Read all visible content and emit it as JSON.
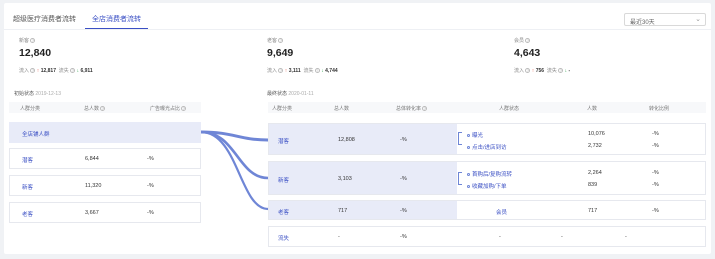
{
  "tabs": [
    {
      "label": "超级医疗消费者流转"
    },
    {
      "label": "全店消费者流转"
    }
  ],
  "select": {
    "value": "最近30天"
  },
  "stats": [
    {
      "label": "新客",
      "value": "12,840",
      "in_label": "流入",
      "in_value": "12,817",
      "out_label": "流失",
      "out_value": "6,911"
    },
    {
      "label": "老客",
      "value": "9,649",
      "in_label": "流入",
      "in_value": "3,111",
      "out_label": "流失",
      "out_value": "4,744"
    },
    {
      "label": "会员",
      "value": "4,643",
      "in_label": "流入",
      "in_value": "756",
      "out_label": "流失",
      "out_value": "-"
    }
  ],
  "left": {
    "date_label": "初始状态",
    "date_value": "2019-12-13",
    "headers": [
      "人群分类",
      "总人数",
      "广告曝光占比"
    ],
    "rows": [
      {
        "name": "全店铺人群",
        "count": "",
        "pct": ""
      },
      {
        "name": "潜客",
        "count": "6,844",
        "pct": "-%"
      },
      {
        "name": "新客",
        "count": "11,320",
        "pct": "-%"
      },
      {
        "name": "老客",
        "count": "3,667",
        "pct": "-%"
      }
    ]
  },
  "right": {
    "date_label": "最终状态",
    "date_value": "2020-01-11",
    "headers": [
      "人群分类",
      "总人数",
      "总体转化率",
      "人群状态",
      "人数",
      "转化比例"
    ],
    "groups": [
      {
        "name": "潜客",
        "count": "12,808",
        "pct": "-%",
        "subs": [
          {
            "label": "曝光",
            "count": "10,076",
            "pct": "-%"
          },
          {
            "label": "点击/进店到访",
            "count": "2,732",
            "pct": "-%"
          }
        ]
      },
      {
        "name": "新客",
        "count": "3,103",
        "pct": "-%",
        "subs": [
          {
            "label": "首购后/复购流转",
            "count": "2,264",
            "pct": "-%"
          },
          {
            "label": "收藏加购/下单",
            "count": "839",
            "pct": "-%"
          }
        ]
      },
      {
        "name": "老客",
        "count": "717",
        "pct": "-%",
        "subs": [
          {
            "label": "会员",
            "count": "717",
            "pct": "-%"
          }
        ]
      },
      {
        "name": "流失",
        "count": "-",
        "pct": "-%",
        "subs": [
          {
            "label": "-",
            "count": "-",
            "pct": "-"
          }
        ]
      }
    ]
  },
  "colors": {
    "accent": "#3a4fc4",
    "flow": "#6f86d6",
    "highlight": "#e8ebf8",
    "up": "#e0392b",
    "down": "#2da44e"
  }
}
